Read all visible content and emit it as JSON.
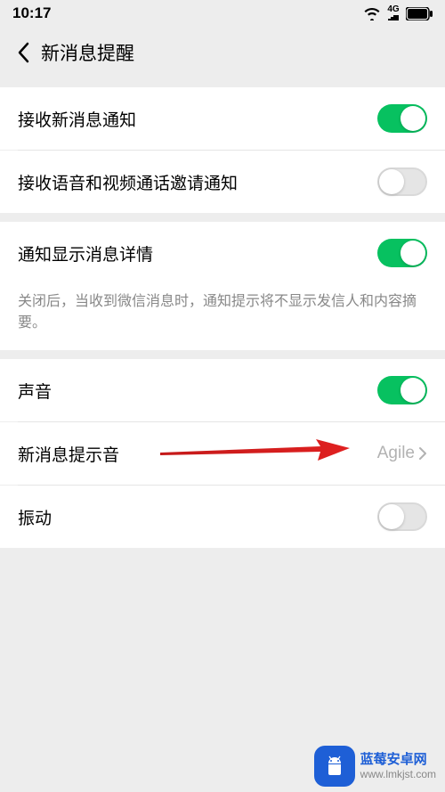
{
  "status": {
    "time": "10:17",
    "network_label": "4G"
  },
  "nav": {
    "title": "新消息提醒"
  },
  "rows": {
    "receive_notify": {
      "label": "接收新消息通知"
    },
    "receive_call": {
      "label": "接收语音和视频通话邀请通知"
    },
    "show_detail": {
      "label": "通知显示消息详情"
    },
    "detail_desc": "关闭后，当收到微信消息时，通知提示将不显示发信人和内容摘要。",
    "sound": {
      "label": "声音"
    },
    "tone": {
      "label": "新消息提示音",
      "value": "Agile"
    },
    "vibrate": {
      "label": "振动"
    }
  },
  "watermark": {
    "name": "蓝莓安卓网",
    "url": "www.lmkjst.com"
  }
}
